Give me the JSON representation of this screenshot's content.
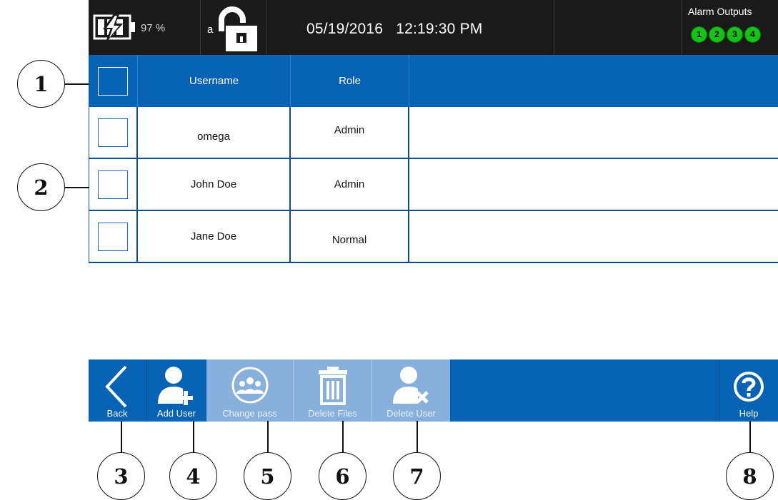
{
  "status_bar": {
    "battery_icon": "battery-charging-icon",
    "battery_percent": "97 %",
    "user_letter": "a",
    "lock_icon": "unlocked-padlock-icon",
    "date": "05/19/2016",
    "time": "12:19:30 PM",
    "alarm_outputs": {
      "title": "Alarm Outputs",
      "items": [
        "1",
        "2",
        "3",
        "4"
      ],
      "color": "#14c314"
    }
  },
  "table": {
    "columns": [
      "Username",
      "Role"
    ],
    "rows": [
      {
        "username": "omega",
        "role": "Admin"
      },
      {
        "username": "John Doe",
        "role": "Admin"
      },
      {
        "username": "Jane Doe",
        "role": "Normal"
      }
    ],
    "header_color": "#0562b4"
  },
  "toolbar": {
    "back": {
      "label": "Back",
      "icon": "chevron-left-icon"
    },
    "add_user": {
      "label": "Add User",
      "icon": "add-user-icon"
    },
    "change_pass": {
      "label": "Change pass",
      "icon": "group-icon",
      "enabled": false
    },
    "delete_files": {
      "label": "Delete Files",
      "icon": "trash-icon",
      "enabled": false
    },
    "delete_user": {
      "label": "Delete User",
      "icon": "remove-user-icon",
      "enabled": false
    },
    "help": {
      "label": "Help",
      "icon": "help-icon"
    }
  },
  "callouts": [
    "1",
    "2",
    "3",
    "4",
    "5",
    "6",
    "7",
    "8"
  ]
}
